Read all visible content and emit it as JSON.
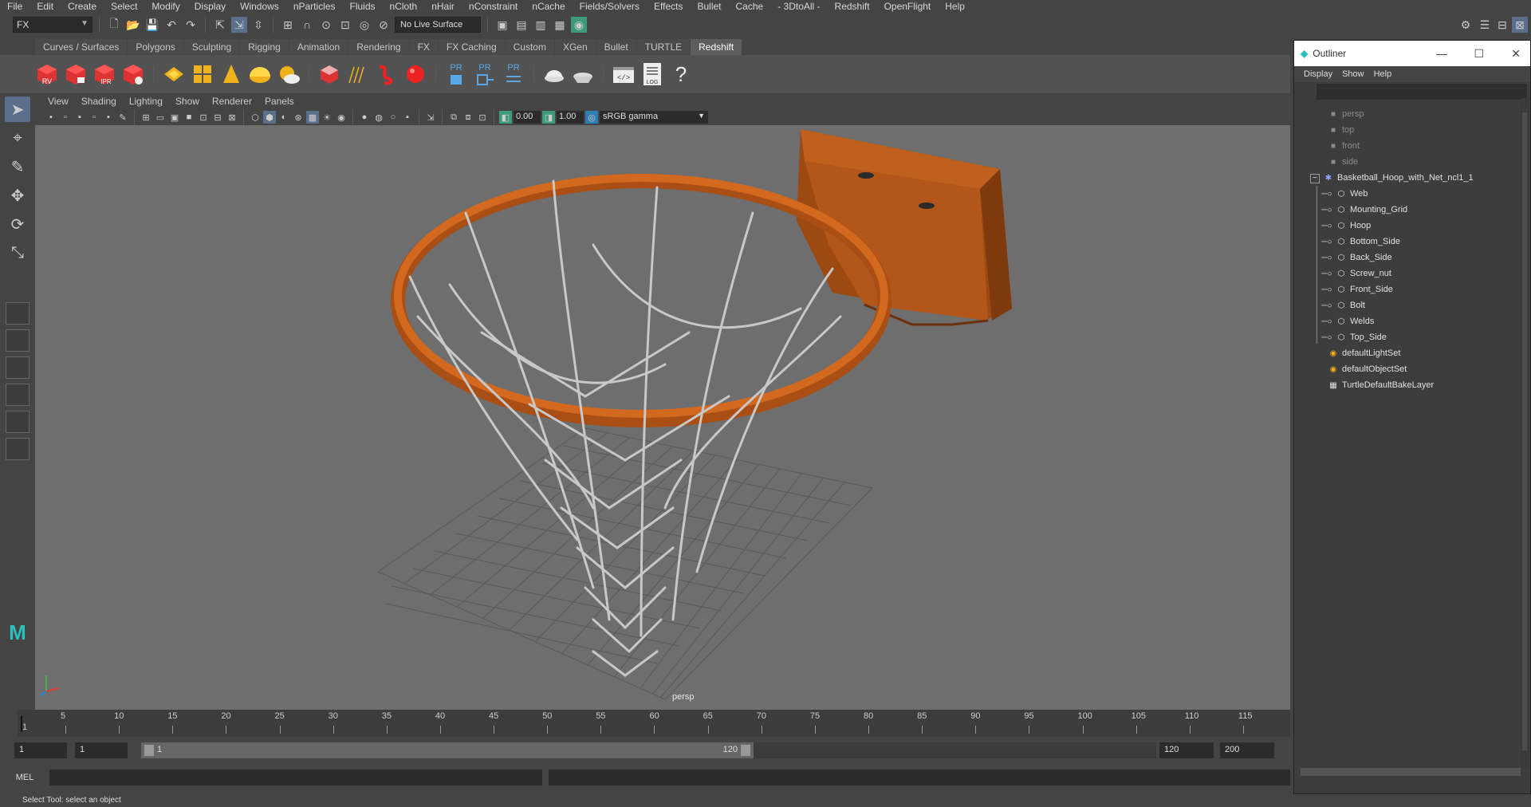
{
  "menubar": {
    "items": [
      "File",
      "Edit",
      "Create",
      "Select",
      "Modify",
      "Display",
      "Windows",
      "nParticles",
      "Fluids",
      "nCloth",
      "nHair",
      "nConstraint",
      "nCache",
      "Fields/Solvers",
      "Effects",
      "Bullet",
      "Cache",
      "- 3DtoAll -",
      "Redshift",
      "OpenFlight",
      "Help"
    ]
  },
  "statusbar": {
    "mode": "FX",
    "live_surface": "No Live Surface"
  },
  "shelf": {
    "tabs": [
      "Curves / Surfaces",
      "Polygons",
      "Sculpting",
      "Rigging",
      "Animation",
      "Rendering",
      "FX",
      "FX Caching",
      "Custom",
      "XGen",
      "Bullet",
      "TURTLE",
      "Redshift"
    ],
    "active_tab": "Redshift",
    "icon_labels": [
      "RV",
      "",
      "IPR",
      ""
    ],
    "pr_labels": [
      "PR",
      "PR",
      "PR"
    ],
    "log_label": "LOG",
    "help_glyph": "?"
  },
  "viewport": {
    "menu": [
      "View",
      "Shading",
      "Lighting",
      "Show",
      "Renderer",
      "Panels"
    ],
    "exposure": "0.00",
    "gamma": "1.00",
    "colorspace": "sRGB gamma",
    "camera": "persp"
  },
  "timeline": {
    "ticks": [
      "5",
      "10",
      "15",
      "20",
      "25",
      "30",
      "35",
      "40",
      "45",
      "50",
      "55",
      "60",
      "65",
      "70",
      "75",
      "80",
      "85",
      "90",
      "95",
      "100",
      "105",
      "110",
      "115"
    ],
    "current_frame": "1"
  },
  "range": {
    "start": "1",
    "anim_start": "1",
    "slider_start": "1",
    "slider_end": "120",
    "end": "120",
    "anim_end": "200"
  },
  "mel": {
    "label": "MEL"
  },
  "helpline": "Select Tool: select an object",
  "outliner": {
    "title": "Outliner",
    "menu": [
      "Display",
      "Show",
      "Help"
    ],
    "cameras": [
      "persp",
      "top",
      "front",
      "side"
    ],
    "group": "Basketball_Hoop_with_Net_ncl1_1",
    "children": [
      "Web",
      "Mounting_Grid",
      "Hoop",
      "Bottom_Side",
      "Back_Side",
      "Screw_nut",
      "Front_Side",
      "Bolt",
      "Welds",
      "Top_Side"
    ],
    "sets": [
      "defaultLightSet",
      "defaultObjectSet",
      "TurtleDefaultBakeLayer"
    ]
  },
  "colors": {
    "hoop": "#d2691e",
    "bracket": "#c0601e",
    "net": "#c8c8c8",
    "viewport_bg": "#6e6e6e",
    "active_tab": "#5d5d5d"
  }
}
